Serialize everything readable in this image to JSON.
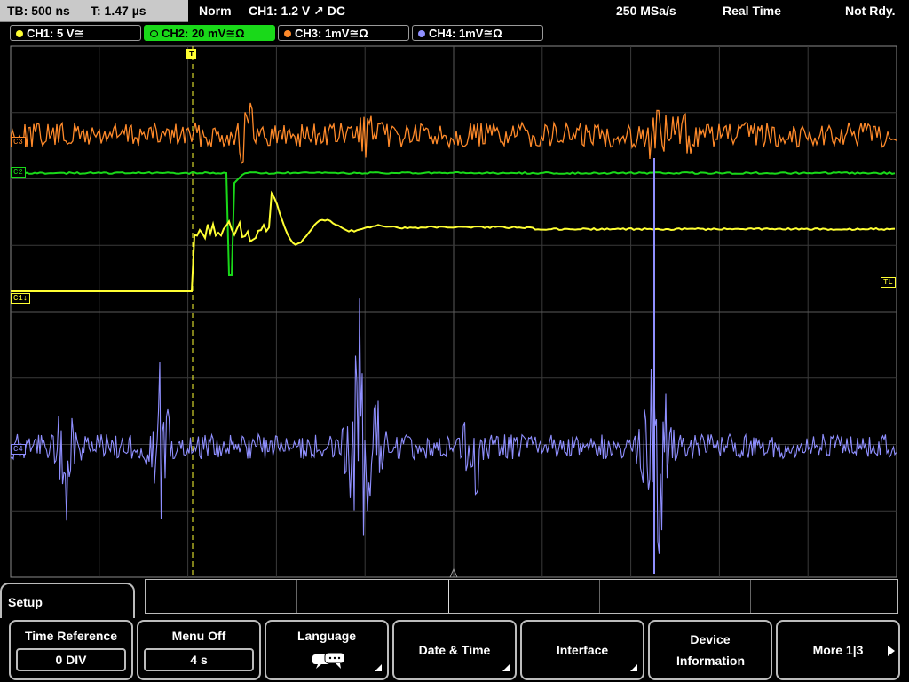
{
  "status": {
    "timebase": "TB: 500 ns",
    "trigger_time": "T: 1.47 µs",
    "trigger_mode": "Norm",
    "trigger_info": "CH1: 1.2 V ↗ DC",
    "sample_rate": "250 MSa/s",
    "acq_mode": "Real Time",
    "state": "Not Rdy."
  },
  "channels": [
    {
      "label": "CH1: 5 V≅",
      "color": "#ffff33"
    },
    {
      "label": "CH2: 20 mV≅Ω",
      "color": "#19d919"
    },
    {
      "label": "CH3: 1mV≅Ω",
      "color": "#ff8a2a"
    },
    {
      "label": "CH4: 1mV≅Ω",
      "color": "#8f8fff"
    }
  ],
  "markers": {
    "ch1_ground": "C1↓",
    "trigger_level": "TL",
    "ch2": "C2",
    "ch3": "C3",
    "ch4": "C4",
    "trigger_position": "T"
  },
  "menu": {
    "title": "Setup",
    "softkeys": [
      {
        "label": "Time Reference",
        "value": "0 DIV"
      },
      {
        "label": "Menu Off",
        "value": "4 s"
      },
      {
        "label": "Language",
        "icon": "speech-bubble-icon"
      },
      {
        "label": "Date & Time"
      },
      {
        "label": "Interface"
      },
      {
        "label": "Device Information"
      },
      {
        "label": "More 1|3"
      }
    ]
  }
}
